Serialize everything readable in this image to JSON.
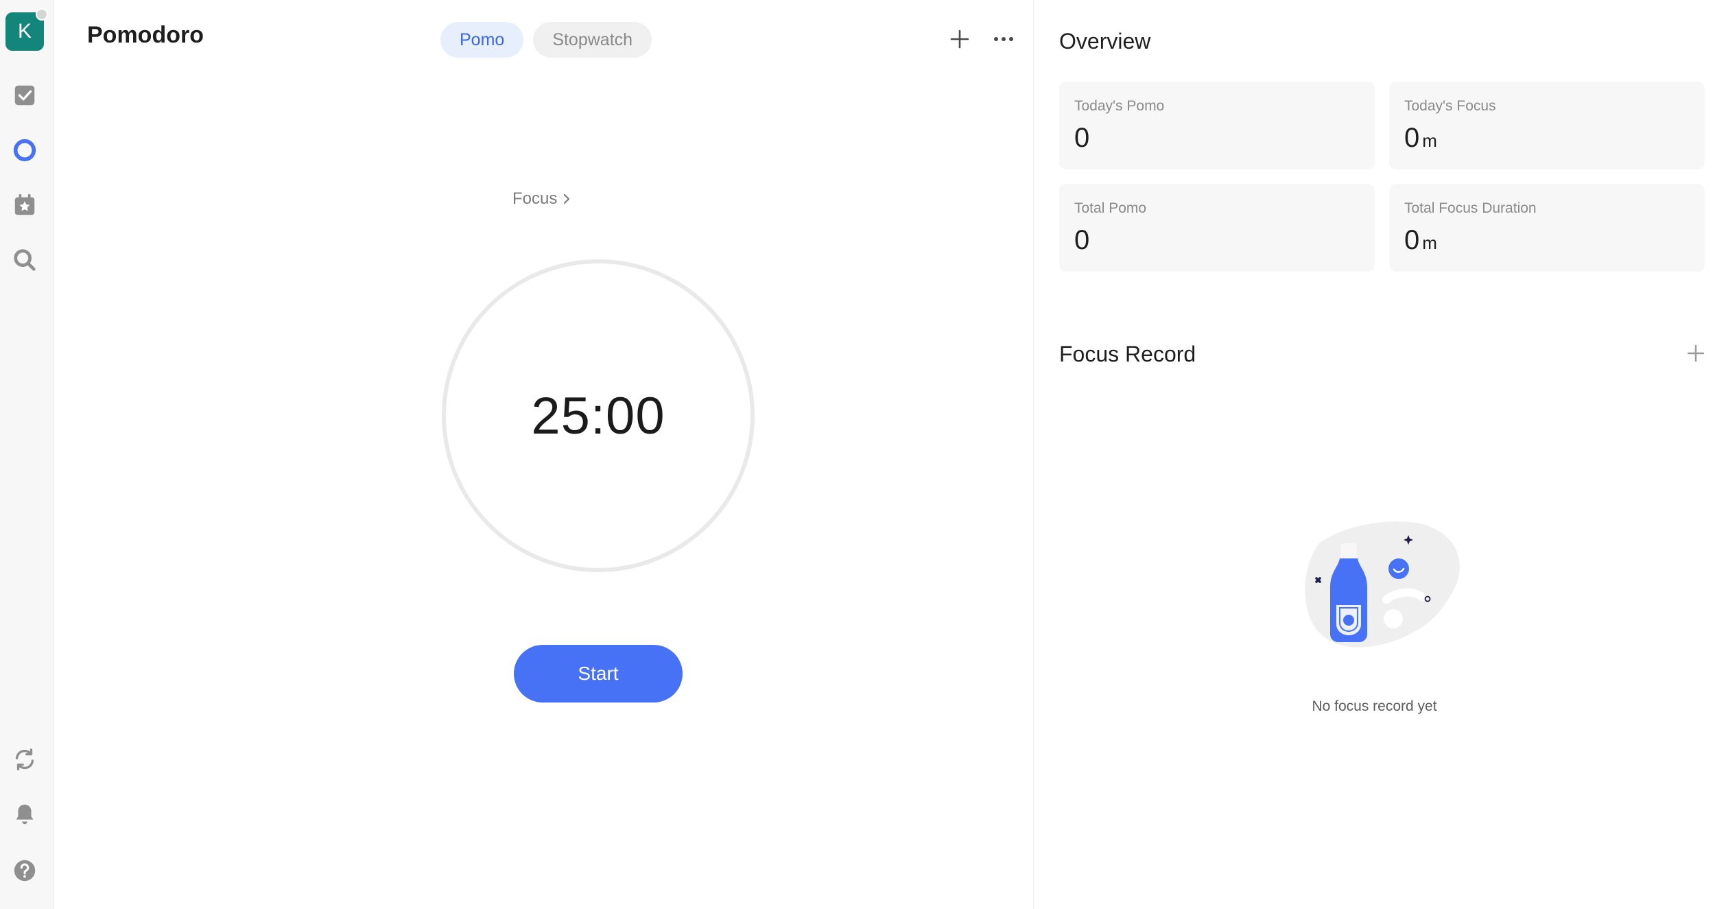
{
  "sidebar": {
    "avatar_letter": "K",
    "icons": [
      "tasks-icon",
      "pomodoro-icon",
      "habit-calendar-icon",
      "search-icon",
      "sync-icon",
      "notification-bell-icon",
      "help-icon"
    ],
    "active_item": "pomodoro-icon",
    "active_color": "#4772f5",
    "avatar_color": "#13857a"
  },
  "header": {
    "title": "Pomodoro",
    "tabs": [
      {
        "label": "Pomo",
        "active": true
      },
      {
        "label": "Stopwatch",
        "active": false
      }
    ],
    "actions": [
      "add-icon",
      "more-icon"
    ]
  },
  "timer": {
    "mode_label": "Focus",
    "time": "25:00",
    "start_label": "Start"
  },
  "overview": {
    "title": "Overview",
    "cards": [
      {
        "label": "Today's Pomo",
        "value": "0",
        "unit": ""
      },
      {
        "label": "Today's Focus",
        "value": "0",
        "unit": "m"
      },
      {
        "label": "Total Pomo",
        "value": "0",
        "unit": ""
      },
      {
        "label": "Total Focus Duration",
        "value": "0",
        "unit": "m"
      }
    ]
  },
  "focus_record": {
    "title": "Focus Record",
    "empty_text": "No focus record yet"
  }
}
